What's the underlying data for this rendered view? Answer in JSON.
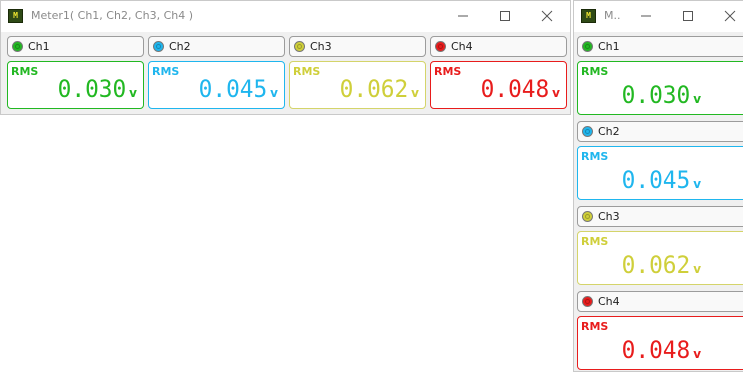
{
  "colors": {
    "ch1": "#22b822",
    "ch2": "#1fb6ee",
    "ch3": "#cfcf3a",
    "ch4": "#e81c1c"
  },
  "window1": {
    "title": "Meter1( Ch1, Ch2, Ch3, Ch4 )",
    "icon": "meter-app-icon"
  },
  "window2": {
    "title": "M..",
    "icon": "meter-app-icon"
  },
  "channels": [
    {
      "name": "Ch1",
      "measure": "RMS",
      "value": "0.030",
      "unit": "v"
    },
    {
      "name": "Ch2",
      "measure": "RMS",
      "value": "0.045",
      "unit": "v"
    },
    {
      "name": "Ch3",
      "measure": "RMS",
      "value": "0.062",
      "unit": "v"
    },
    {
      "name": "Ch4",
      "measure": "RMS",
      "value": "0.048",
      "unit": "v"
    }
  ]
}
